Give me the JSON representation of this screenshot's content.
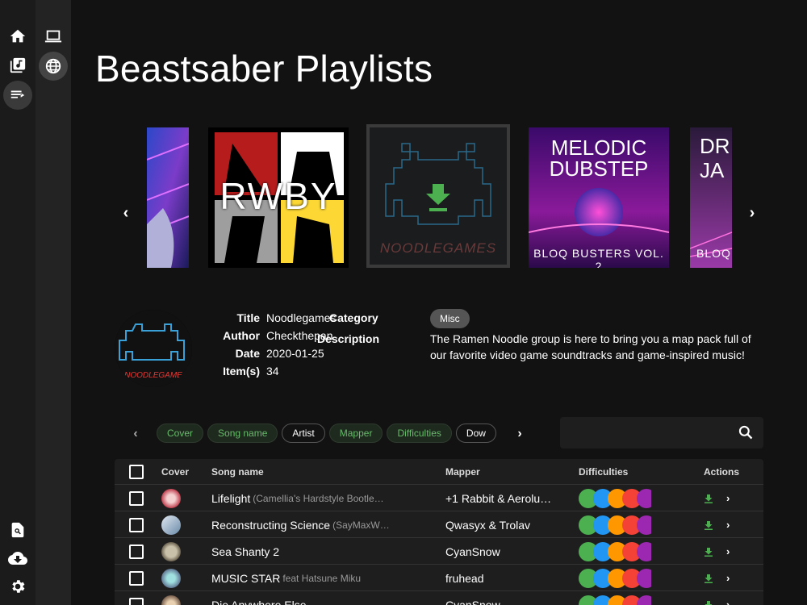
{
  "window": {
    "minimize": "—",
    "maximize": "□",
    "close": "✕"
  },
  "sidebar": {
    "items": [
      {
        "icon": "home-icon"
      },
      {
        "icon": "library-icon"
      },
      {
        "icon": "playlist-icon"
      }
    ],
    "bottom": [
      {
        "icon": "search-file-icon"
      },
      {
        "icon": "cloud-download-icon"
      },
      {
        "icon": "gear-icon"
      }
    ]
  },
  "subbar": {
    "items": [
      {
        "icon": "laptop-icon"
      },
      {
        "icon": "globe-icon"
      }
    ]
  },
  "page": {
    "title": "Beastsaber Playlists"
  },
  "carousel": {
    "covers": [
      {
        "text": ""
      },
      {
        "text": "RWBY"
      },
      {
        "text": "NOODLEGAMES"
      },
      {
        "text": "MELODIC DUBSTEP",
        "sub": "BLOQ BUSTERS VOL. 2"
      },
      {
        "text": "DR\nJA",
        "sub": "BLOQ"
      }
    ]
  },
  "details": {
    "avatar_text": "NOODLEGAME",
    "title_label": "Title",
    "title": "Noodlegames",
    "author_label": "Author",
    "author": "Checkthepan",
    "date_label": "Date",
    "date": "2020-01-25",
    "items_label": "Item(s)",
    "items": "34",
    "category_label": "Category",
    "category": "Misc",
    "description_label": "Description",
    "description": "The Ramen Noodle group is here to bring you a map pack full of our favorite video game soundtracks and game-inspired music!"
  },
  "filters": {
    "chips": [
      {
        "label": "Cover",
        "on": true
      },
      {
        "label": "Song name",
        "on": true
      },
      {
        "label": "Artist",
        "on": false
      },
      {
        "label": "Mapper",
        "on": true
      },
      {
        "label": "Difficulties",
        "on": true
      },
      {
        "label": "Dow",
        "on": false
      }
    ]
  },
  "search": {
    "placeholder": ""
  },
  "table": {
    "headers": {
      "cover": "Cover",
      "song": "Song name",
      "mapper": "Mapper",
      "difficulties": "Difficulties",
      "actions": "Actions"
    },
    "rows": [
      {
        "song": "Lifelight",
        "sub": "(Camellia's Hardstyle Bootle…",
        "mapper": "+1 Rabbit & Aerolu…"
      },
      {
        "song": "Reconstructing Science",
        "sub": "(SayMaxW…",
        "mapper": "Qwasyx & Trolav"
      },
      {
        "song": "Sea Shanty 2",
        "sub": "",
        "mapper": "CyanSnow"
      },
      {
        "song": "MUSIC STAR",
        "sub": "feat Hatsune Miku",
        "mapper": "fruhead"
      },
      {
        "song": "Die Anywhere Else",
        "sub": "",
        "mapper": "CyanSnow"
      }
    ]
  },
  "colors": {
    "accent_green": "#66bb6a",
    "diff_easy": "#4caf50",
    "diff_normal": "#2196f3",
    "diff_hard": "#ff9800",
    "diff_expert": "#f44336",
    "diff_plus": "#9c27b0"
  }
}
